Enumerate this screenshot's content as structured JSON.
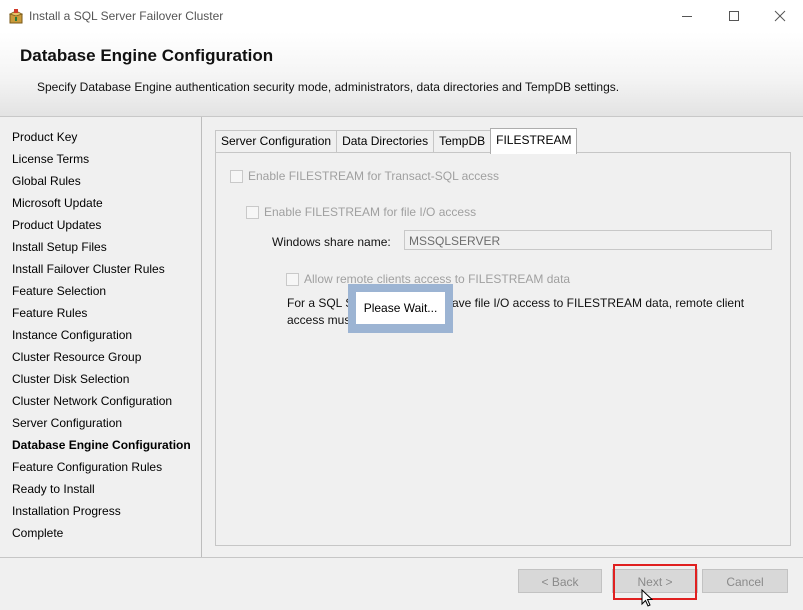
{
  "window": {
    "title": "Install a SQL Server Failover Cluster",
    "app_icon": "sql-setup-box-icon",
    "controls": [
      "minimize-icon",
      "maximize-icon",
      "close-icon"
    ]
  },
  "header": {
    "title": "Database Engine Configuration",
    "description": "Specify Database Engine authentication security mode, administrators, data directories and TempDB settings."
  },
  "sidebar": {
    "items": [
      {
        "label": "Product Key"
      },
      {
        "label": "License Terms"
      },
      {
        "label": "Global Rules"
      },
      {
        "label": "Microsoft Update"
      },
      {
        "label": "Product Updates"
      },
      {
        "label": "Install Setup Files"
      },
      {
        "label": "Install Failover Cluster Rules"
      },
      {
        "label": "Feature Selection"
      },
      {
        "label": "Feature Rules"
      },
      {
        "label": "Instance Configuration"
      },
      {
        "label": "Cluster Resource Group"
      },
      {
        "label": "Cluster Disk Selection"
      },
      {
        "label": "Cluster Network Configuration"
      },
      {
        "label": "Server Configuration"
      },
      {
        "label": "Database Engine Configuration",
        "active": true
      },
      {
        "label": "Feature Configuration Rules"
      },
      {
        "label": "Ready to Install"
      },
      {
        "label": "Installation Progress"
      },
      {
        "label": "Complete"
      }
    ]
  },
  "tabs": [
    {
      "label": "Server Configuration"
    },
    {
      "label": "Data Directories"
    },
    {
      "label": "TempDB"
    },
    {
      "label": "FILESTREAM",
      "active": true
    }
  ],
  "filestream": {
    "enable_tsql_label": "Enable FILESTREAM for Transact-SQL access",
    "enable_fileio_label": "Enable FILESTREAM for file I/O access",
    "share_name_label": "Windows share name:",
    "share_name_value": "MSSQLSERVER",
    "allow_remote_label": "Allow remote clients access to FILESTREAM data",
    "info_text": "For a SQL Server instance to have file I/O access to FILESTREAM data, remote client access must be enabled."
  },
  "overlay": {
    "text": "Please Wait..."
  },
  "footer": {
    "back_label": "< Back",
    "next_label": "Next >",
    "cancel_label": "Cancel"
  },
  "colors": {
    "highlight": "#e02020",
    "overlay_border": "#9cb4d3"
  }
}
